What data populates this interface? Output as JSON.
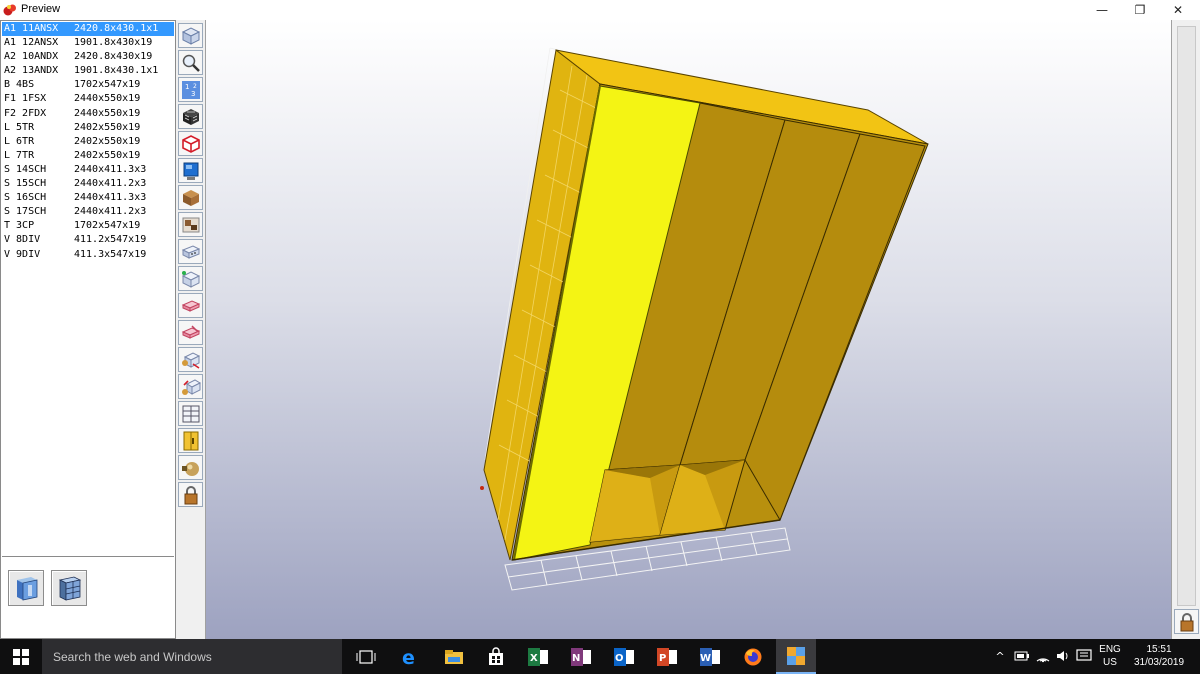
{
  "window": {
    "title": "Preview",
    "minimize_glyph": "—",
    "maximize_glyph": "❐",
    "close_glyph": "✕"
  },
  "parts": [
    {
      "code": "A1 11ANSX",
      "size": "2420.8x430.1x1"
    },
    {
      "code": "A1 12ANSX",
      "size": "1901.8x430x19"
    },
    {
      "code": "A2 10ANDX",
      "size": "2420.8x430x19"
    },
    {
      "code": "A2 13ANDX",
      "size": "1901.8x430.1x1"
    },
    {
      "code": "B 4BS",
      "size": "1702x547x19"
    },
    {
      "code": "F1 1FSX",
      "size": "2440x550x19"
    },
    {
      "code": "F2 2FDX",
      "size": "2440x550x19"
    },
    {
      "code": "L 5TR",
      "size": "2402x550x19"
    },
    {
      "code": "L 6TR",
      "size": "2402x550x19"
    },
    {
      "code": "L 7TR",
      "size": "2402x550x19"
    },
    {
      "code": "S 14SCH",
      "size": "2440x411.3x3"
    },
    {
      "code": "S 15SCH",
      "size": "2440x411.2x3"
    },
    {
      "code": "S 16SCH",
      "size": "2440x411.3x3"
    },
    {
      "code": "S 17SCH",
      "size": "2440x411.2x3"
    },
    {
      "code": "T 3CP",
      "size": "1702x547x19"
    },
    {
      "code": "V 8DIV",
      "size": "411.2x547x19"
    },
    {
      "code": "V 9DIV",
      "size": "411.3x547x19"
    }
  ],
  "selected_part_index": 0,
  "toolbar_icons": [
    "view-cube-icon",
    "zoom-icon",
    "numbered-cubes-icon",
    "wireframe-cube-icon",
    "red-outline-cube-icon",
    "monitor-icon",
    "wood-texture-icon",
    "material-swatch-icon",
    "panel-dots-icon",
    "panel-add-icon",
    "pink-panel-icon",
    "panel-edit-icon",
    "panel-move-icon",
    "panel-transfer-icon",
    "grid-layout-icon",
    "door-handle-icon",
    "knob-icon",
    "lock-icon"
  ],
  "right_strip_icon": "lock-icon",
  "panel_buttons": [
    "cabinet-front-icon",
    "cabinet-wireframe-icon"
  ],
  "taskbar": {
    "search_placeholder": "Search the web and Windows",
    "apps": [
      "task-view-icon",
      "edge-icon",
      "file-explorer-icon",
      "store-icon",
      "excel-icon",
      "onenote-icon",
      "outlook-icon",
      "powerpoint-icon",
      "word-icon",
      "firefox-icon",
      "cabinet-app-icon"
    ],
    "active_app": "cabinet-app-icon",
    "language_line1": "ENG",
    "language_line2": "US",
    "time": "15:51",
    "date": "31/03/2019"
  },
  "colors": {
    "cabinet_front": "#b8900e",
    "cabinet_side": "#e0b410",
    "cabinet_top": "#f2c414",
    "open_door": "#f4f414",
    "selection": "#3399ff",
    "taskbar": "#0f0f10"
  }
}
